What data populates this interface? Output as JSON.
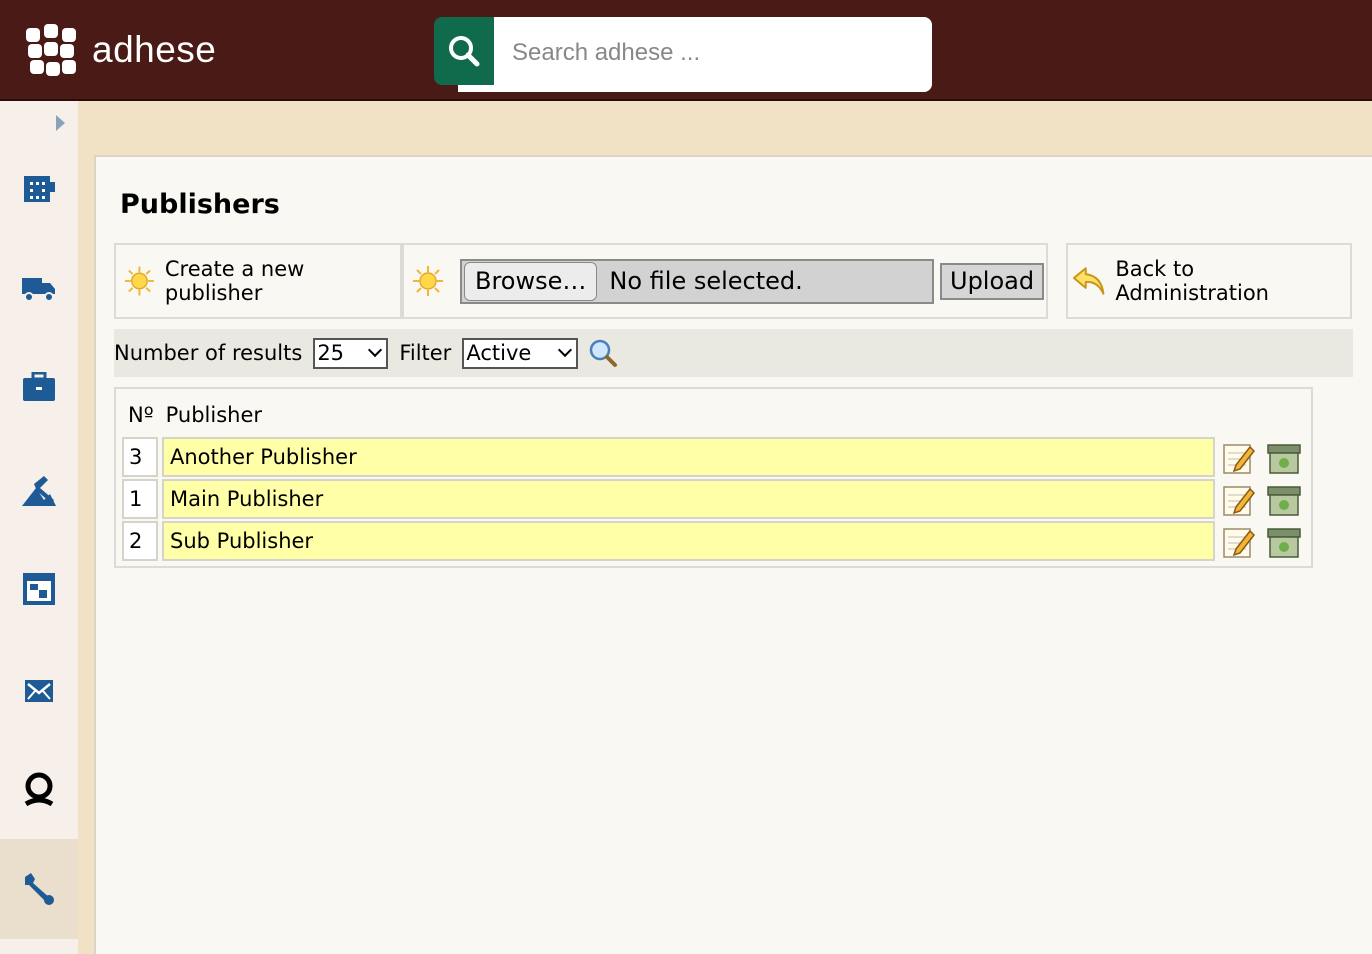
{
  "app": {
    "name": "adhese"
  },
  "search": {
    "placeholder": "Search adhese ..."
  },
  "sidebar": {
    "items": [
      {
        "id": "dashboard",
        "icon": "building-icon"
      },
      {
        "id": "delivery",
        "icon": "truck-icon"
      },
      {
        "id": "campaigns",
        "icon": "briefcase-icon"
      },
      {
        "id": "tools",
        "icon": "hammer-icon"
      },
      {
        "id": "calendar",
        "icon": "calendar-icon"
      },
      {
        "id": "mail",
        "icon": "mail-icon"
      },
      {
        "id": "user",
        "icon": "user-icon"
      },
      {
        "id": "administration",
        "icon": "wrench-icon",
        "active": true
      }
    ]
  },
  "page": {
    "title": "Publishers"
  },
  "toolbar": {
    "create_label": "Create a new publisher",
    "browse_label": "Browse…",
    "file_status": "No file selected.",
    "upload_label": "Upload",
    "back_label": "Back to Administration"
  },
  "filters": {
    "results_label": "Number of results",
    "results_value": "25",
    "filter_label": "Filter",
    "filter_value": "Active"
  },
  "table": {
    "headers": {
      "no": "Nº",
      "publisher": "Publisher"
    },
    "rows": [
      {
        "no": "3",
        "name": "Another Publisher"
      },
      {
        "no": "1",
        "name": "Main Publisher"
      },
      {
        "no": "2",
        "name": "Sub Publisher"
      }
    ]
  },
  "colors": {
    "topbar": "#4a1a17",
    "search_button": "#0f6b4b",
    "nav_icon": "#1d5a96",
    "row_highlight": "#ffffa8"
  }
}
